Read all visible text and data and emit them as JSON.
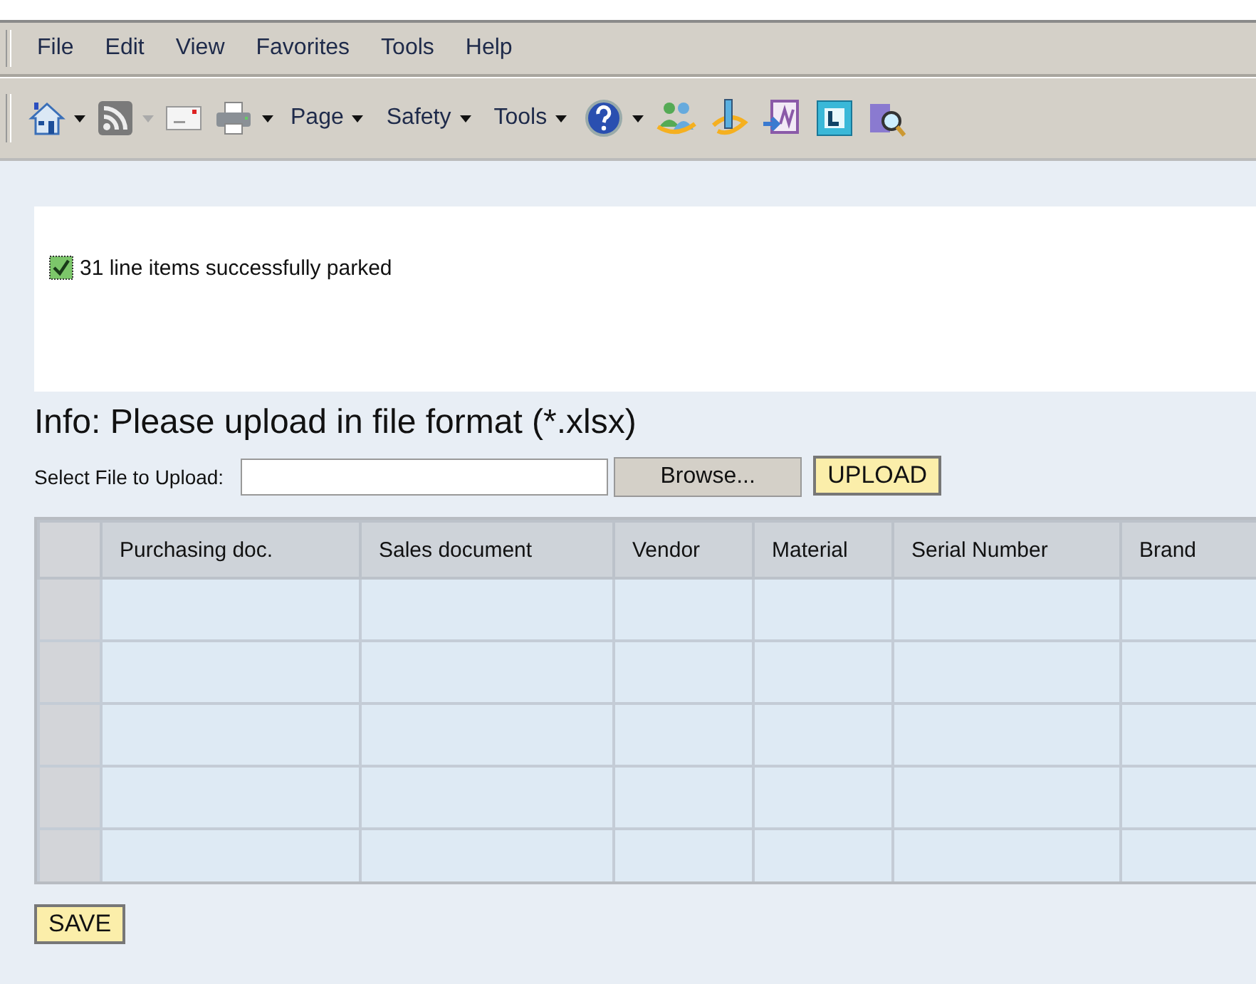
{
  "menu_bar": {
    "items": [
      {
        "label": "File"
      },
      {
        "label": "Edit"
      },
      {
        "label": "View"
      },
      {
        "label": "Favorites"
      },
      {
        "label": "Tools"
      },
      {
        "label": "Help"
      }
    ]
  },
  "toolbar": {
    "menus": [
      {
        "label": "Page"
      },
      {
        "label": "Safety"
      },
      {
        "label": "Tools"
      }
    ]
  },
  "message": {
    "kind": "success",
    "text": "31 line items successfully parked"
  },
  "info": "Info: Please upload in file format (*.xlsx)",
  "upload": {
    "label": "Select File to Upload:",
    "browse": "Browse...",
    "upload_button": "UPLOAD"
  },
  "table": {
    "columns": [
      "Purchasing doc.",
      "Sales document",
      "Vendor",
      "Material",
      "Serial Number",
      "Brand"
    ],
    "rows": [
      {
        "kind": "empty"
      },
      {
        "kind": "empty"
      },
      {
        "kind": "empty"
      },
      {
        "kind": "empty"
      },
      {
        "kind": "empty"
      }
    ]
  },
  "save_button": "SAVE"
}
